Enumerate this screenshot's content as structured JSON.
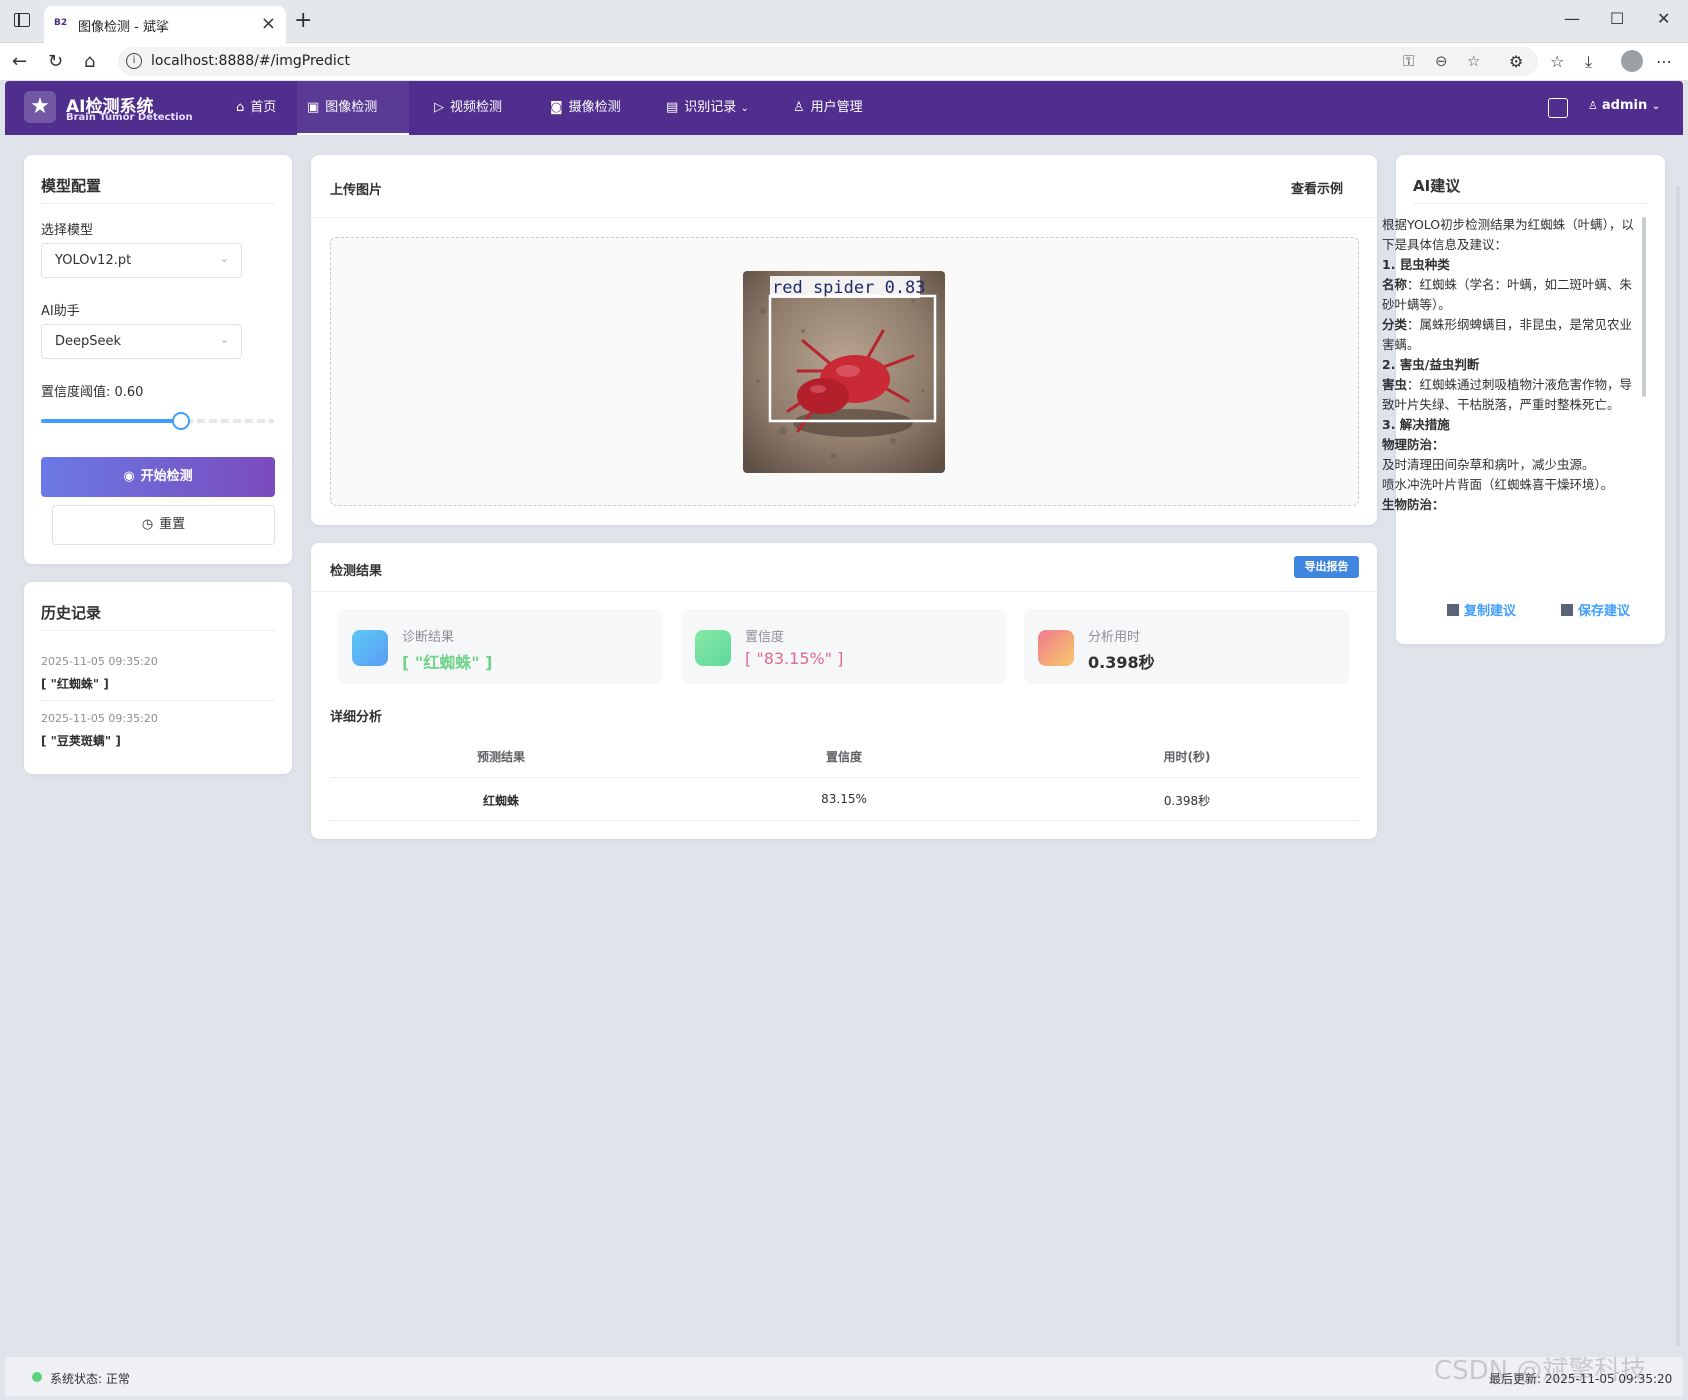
{
  "browser": {
    "tab_title": "图像检测 - 斌挲",
    "favicon": "B2",
    "url": "localhost:8888/#/imgPredict"
  },
  "header": {
    "brand_title": "AI检测系统",
    "brand_subtitle": "Brain Tumor Detection",
    "menu": [
      {
        "label": "首页",
        "icon": "home-icon"
      },
      {
        "label": "图像检测",
        "icon": "image-icon",
        "active": true
      },
      {
        "label": "视频检测",
        "icon": "play-icon"
      },
      {
        "label": "摄像检测",
        "icon": "camera-icon"
      },
      {
        "label": "识别记录",
        "icon": "document-icon"
      },
      {
        "label": "用户管理",
        "icon": "user-icon"
      }
    ],
    "user": "admin",
    "accent_color": "#4f2e8e"
  },
  "model_config": {
    "title": "模型配置",
    "model_label": "选择模型",
    "model_value": "YOLOv12.pt",
    "assistant_label": "AI助手",
    "assistant_value": "DeepSeek",
    "confidence_label": "置信度阈值: 0.60",
    "confidence_value": 0.6,
    "start_button": "开始检测",
    "reset_button": "重置"
  },
  "history": {
    "title": "历史记录",
    "items": [
      {
        "date": "2025-11-05 09:35:20",
        "value": "[ \"红蜘蛛\" ]"
      },
      {
        "date": "2025-11-05 09:35:20",
        "value": "[ \"豆荚斑螨\" ]"
      }
    ]
  },
  "upload": {
    "title": "上传图片",
    "example_link": "查看示例",
    "detection_label": "red spider 0.83"
  },
  "results": {
    "title": "检测结果",
    "export_button": "导出报告",
    "stats": [
      {
        "label": "诊断结果",
        "value": "[ \"红蜘蛛\" ]",
        "color": "#6fd38a"
      },
      {
        "label": "置信度",
        "value": "[ \"83.15%\" ]",
        "color": "#e06b8b"
      },
      {
        "label": "分析用时",
        "value": "0.398秒",
        "color": "#303133"
      }
    ],
    "detail_title": "详细分析",
    "table_headers": [
      "预测结果",
      "置信度",
      "用时(秒)"
    ],
    "table_rows": [
      [
        "红蜘蛛",
        "83.15%",
        "0.398秒"
      ]
    ]
  },
  "ai_advice": {
    "title": "AI建议",
    "intro": "根据YOLO初步检测结果为红蜘蛛（叶螨），以下是具体信息及建议：",
    "s1_title": "1. 昆虫种类",
    "s1_name_label": "名称",
    "s1_name_text": "：红蜘蛛（学名：叶螨，如二斑叶螨、朱砂叶螨等）。",
    "s1_class_label": "分类",
    "s1_class_text": "：属蛛形纲蜱螨目，非昆虫，是常见农业害螨。",
    "s2_title": "2. 害虫/益虫判断",
    "s2_label": "害虫",
    "s2_text": "：红蜘蛛通过刺吸植物汁液危害作物，导致叶片失绿、干枯脱落，严重时整株死亡。",
    "s3_title": "3. 解决措施",
    "s3_sub": "物理防治：",
    "s3_p1": "及时清理田间杂草和病叶，减少虫源。",
    "s3_p2": "喷水冲洗叶片背面（红蜘蛛喜干燥环境）。",
    "s3_cut": "生物防治：",
    "copy_button": "复制建议",
    "save_button": "保存建议"
  },
  "footer": {
    "status": "系统状态: 正常",
    "updated": "最后更新: 2025-11-05 09:35:20",
    "watermark": "CSDN @斌擎科技"
  }
}
